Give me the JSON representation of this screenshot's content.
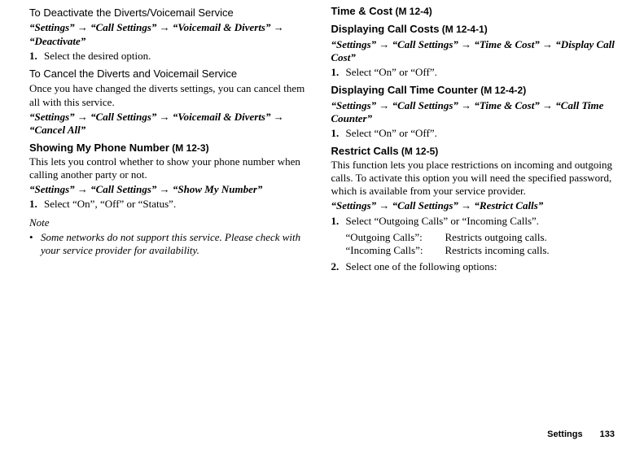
{
  "left": {
    "deact": {
      "heading": "To Deactivate the Diverts/Voicemail Service",
      "path": "“Settings” → “Call Settings” → “Voicemail & Diverts” → “Deactivate”",
      "step1_num": "1.",
      "step1_text": "Select the desired option."
    },
    "cancel": {
      "heading": "To Cancel the Diverts and Voicemail Service",
      "desc": "Once you have changed the diverts settings, you can cancel them all with this service.",
      "path": "“Settings” → “Call Settings” → “Voicemail & Diverts” → “Cancel All”"
    },
    "show_number": {
      "heading": "Showing My Phone Number",
      "menu_ref": " (M 12-3)",
      "desc": "This lets you control whether to show your phone number when calling another party or not.",
      "path": "“Settings” → “Call Settings” → “Show My Number”",
      "step1_num": "1.",
      "step1_text": "Select “On”, “Off” or “Status”.",
      "note_label": "Note",
      "note_bullet": "•",
      "note_text": "Some networks do not support this service. Please check with your service provider for availability."
    }
  },
  "right": {
    "time_cost": {
      "heading": "Time & Cost",
      "menu_ref": " (M 12-4)"
    },
    "disp_cost": {
      "heading": "Displaying Call Costs",
      "menu_ref": " (M 12-4-1)",
      "path": "“Settings” → “Call Settings” → “Time & Cost” → “Display Call Cost”",
      "step1_num": "1.",
      "step1_text": "Select “On” or “Off”."
    },
    "call_timer": {
      "heading": "Displaying Call Time Counter",
      "menu_ref": " (M 12-4-2)",
      "path": "“Settings” → “Call Settings” → “Time & Cost” → “Call Time Counter”",
      "step1_num": "1.",
      "step1_text": "Select “On” or “Off”."
    },
    "restrict": {
      "heading": "Restrict Calls",
      "menu_ref": " (M 12-5)",
      "desc": "This function lets you place restrictions on incoming and outgoing calls. To activate this option you will need the specified password, which is available from your service provider.",
      "path": "“Settings” → “Call Settings” → “Restrict Calls”",
      "step1_num": "1.",
      "step1_text": "Select “Outgoing Calls” or “Incoming Calls”.",
      "table": {
        "out_key": "“Outgoing Calls”:",
        "out_val": "Restricts outgoing calls.",
        "in_key": "“Incoming Calls”:",
        "in_val": "Restricts incoming calls."
      },
      "step2_num": "2.",
      "step2_text": "Select one of the following options:"
    }
  },
  "footer": {
    "section": "Settings",
    "page": "133"
  }
}
